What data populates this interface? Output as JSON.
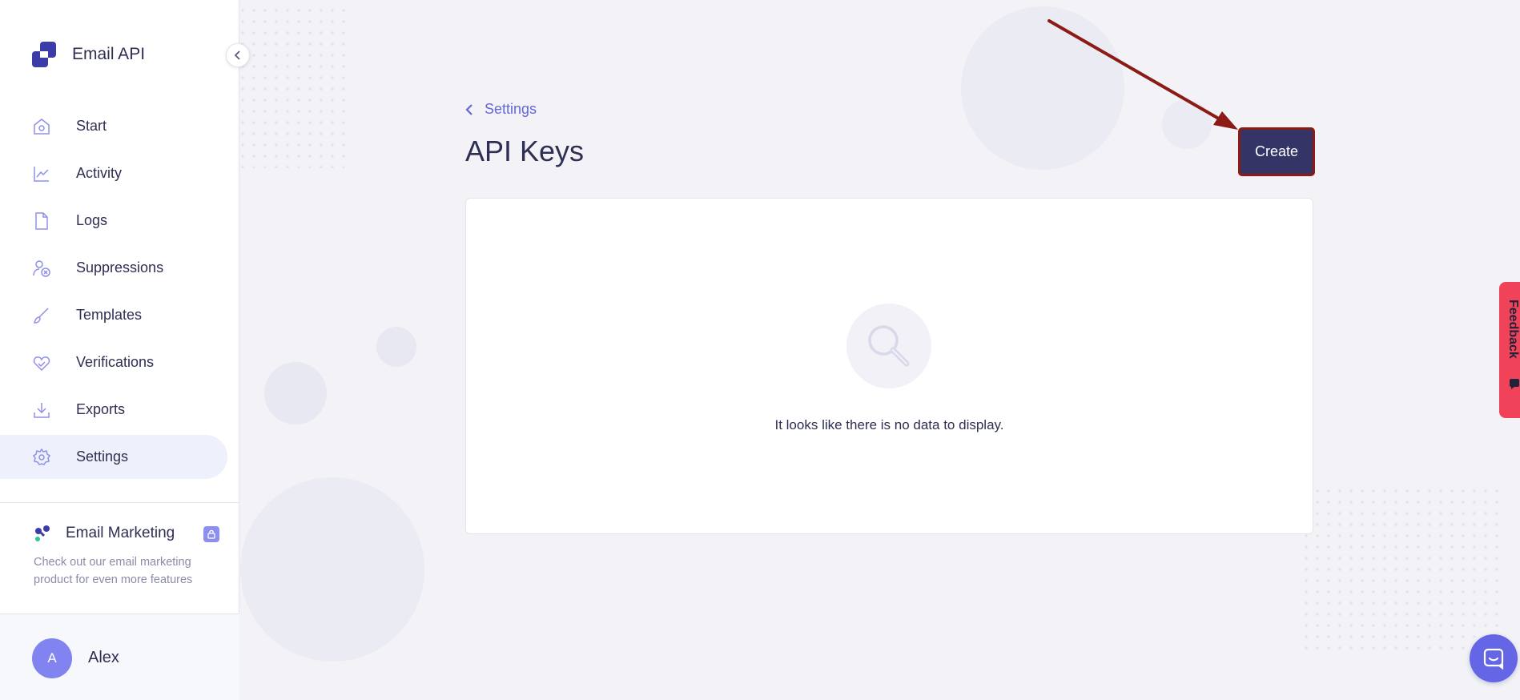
{
  "app": {
    "brand_name": "Email API",
    "brand_icon": "email-api-logo"
  },
  "colors": {
    "accent": "#6467d6",
    "primary_button": "#343566",
    "active_nav_bg": "#eef0fb",
    "avatar": "#8183f0",
    "feedback_tab": "#f0435a",
    "chat_button": "#6466e6",
    "annotation": "#8b1b14"
  },
  "sidebar": {
    "items": [
      {
        "label": "Start",
        "icon": "home-icon",
        "active": false
      },
      {
        "label": "Activity",
        "icon": "chart-icon",
        "active": false
      },
      {
        "label": "Logs",
        "icon": "file-icon",
        "active": false
      },
      {
        "label": "Suppressions",
        "icon": "user-block-icon",
        "active": false
      },
      {
        "label": "Templates",
        "icon": "brush-icon",
        "active": false
      },
      {
        "label": "Verifications",
        "icon": "heart-check-icon",
        "active": false
      },
      {
        "label": "Exports",
        "icon": "download-icon",
        "active": false
      },
      {
        "label": "Settings",
        "icon": "gear-icon",
        "active": true
      }
    ],
    "promo": {
      "title": "Email Marketing",
      "text": "Check out our email marketing product for even more features",
      "badge_icon": "lock-icon"
    },
    "user": {
      "initial": "A",
      "name": "Alex"
    }
  },
  "main": {
    "back_label": "Settings",
    "title": "API Keys",
    "create_label": "Create",
    "empty_state": {
      "icon": "search-icon",
      "message": "It looks like there is no data to display."
    }
  },
  "feedback": {
    "label": "Feedback"
  }
}
